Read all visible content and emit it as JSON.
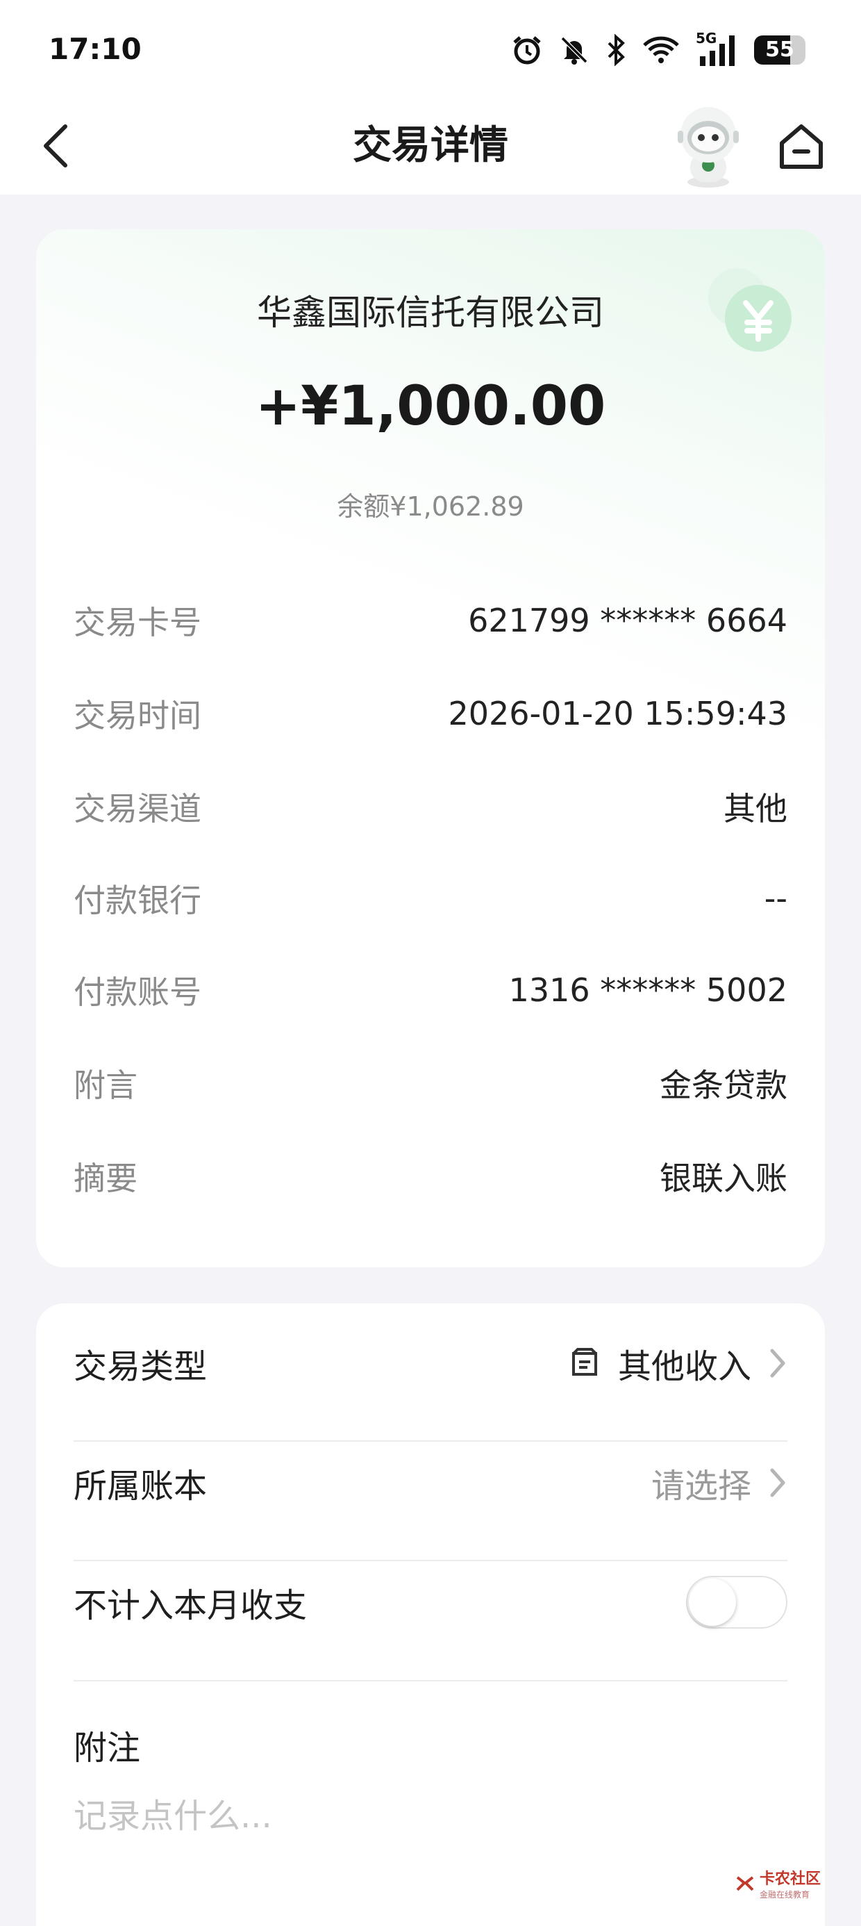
{
  "status_bar": {
    "time": "17:10",
    "network_label": "5G",
    "battery_level": "55"
  },
  "header": {
    "title": "交易详情"
  },
  "transaction": {
    "payee": "华鑫国际信托有限公司",
    "amount": "+¥1,000.00",
    "balance": "余额¥1,062.89",
    "details": [
      {
        "label": "交易卡号",
        "value": "621799 ****** 6664"
      },
      {
        "label": "交易时间",
        "value": "2026-01-20 15:59:43"
      },
      {
        "label": "交易渠道",
        "value": "其他"
      },
      {
        "label": "付款银行",
        "value": "--"
      },
      {
        "label": "付款账号",
        "value": "1316 ****** 5002"
      },
      {
        "label": "附言",
        "value": "金条贷款"
      },
      {
        "label": "摘要",
        "value": "银联入账"
      }
    ]
  },
  "settings": {
    "type_label": "交易类型",
    "type_value": "其他收入",
    "ledger_label": "所属账本",
    "ledger_value": "请选择",
    "exclude_label": "不计入本月收支",
    "exclude_enabled": false,
    "note_label": "附注",
    "note_placeholder": "记录点什么..."
  },
  "watermark": {
    "text": "卡农社区",
    "sub": "金融在线教育"
  },
  "colors": {
    "brand_green": "#4cc17a",
    "background": "#f3f3f8"
  }
}
